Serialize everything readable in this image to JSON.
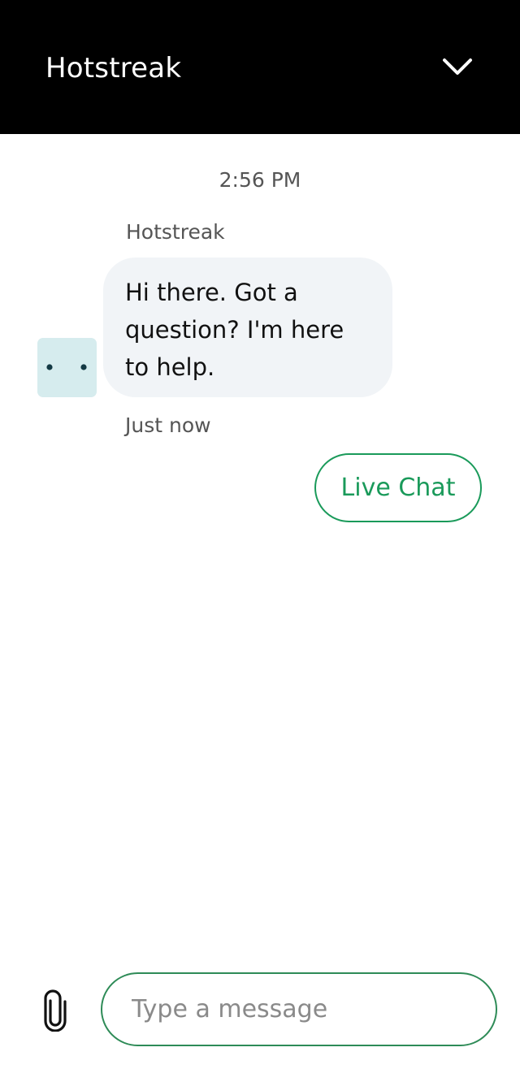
{
  "header": {
    "title": "Hotstreak",
    "collapse_icon": "chevron-down-icon"
  },
  "conversation": {
    "timestamp": "2:56 PM",
    "messages": [
      {
        "sender": "Hotstreak",
        "text": "Hi there. Got a question? I'm here to help.",
        "time": "Just now",
        "avatar_icon": "bot-face-icon"
      }
    ],
    "quick_replies": [
      {
        "label": "Live Chat"
      }
    ]
  },
  "composer": {
    "placeholder": "Type a message",
    "value": "",
    "attach_icon": "paperclip-icon"
  },
  "colors": {
    "header_bg": "#000000",
    "accent": "#1a9a5a",
    "bubble_bg": "#f1f4f7",
    "avatar_bg": "#d6ecee"
  }
}
